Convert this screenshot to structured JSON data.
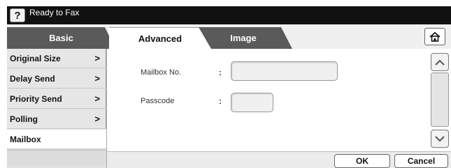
{
  "status": {
    "help_label": "?",
    "text": "Ready to Fax"
  },
  "tabs": [
    {
      "label": "Basic"
    },
    {
      "label": "Advanced"
    },
    {
      "label": "Image"
    }
  ],
  "icons": {
    "help": "help-icon",
    "home": "home-icon",
    "chevron": "chevron-right-icon",
    "scroll_up": "chevron-up-icon",
    "scroll_down": "chevron-down-icon"
  },
  "menu": {
    "items": [
      {
        "label": "Original Size",
        "chevron": ">"
      },
      {
        "label": "Delay Send",
        "chevron": ">"
      },
      {
        "label": "Priority Send",
        "chevron": ">"
      },
      {
        "label": "Polling",
        "chevron": ">"
      },
      {
        "label": "Mailbox"
      }
    ],
    "selected": "Mailbox"
  },
  "form": {
    "mailbox_label": "Mailbox No.",
    "mailbox_colon": ":",
    "mailbox_value": "",
    "passcode_label": "Passcode",
    "passcode_colon": ":",
    "passcode_value": ""
  },
  "buttons": {
    "ok": "OK",
    "cancel": "Cancel"
  }
}
